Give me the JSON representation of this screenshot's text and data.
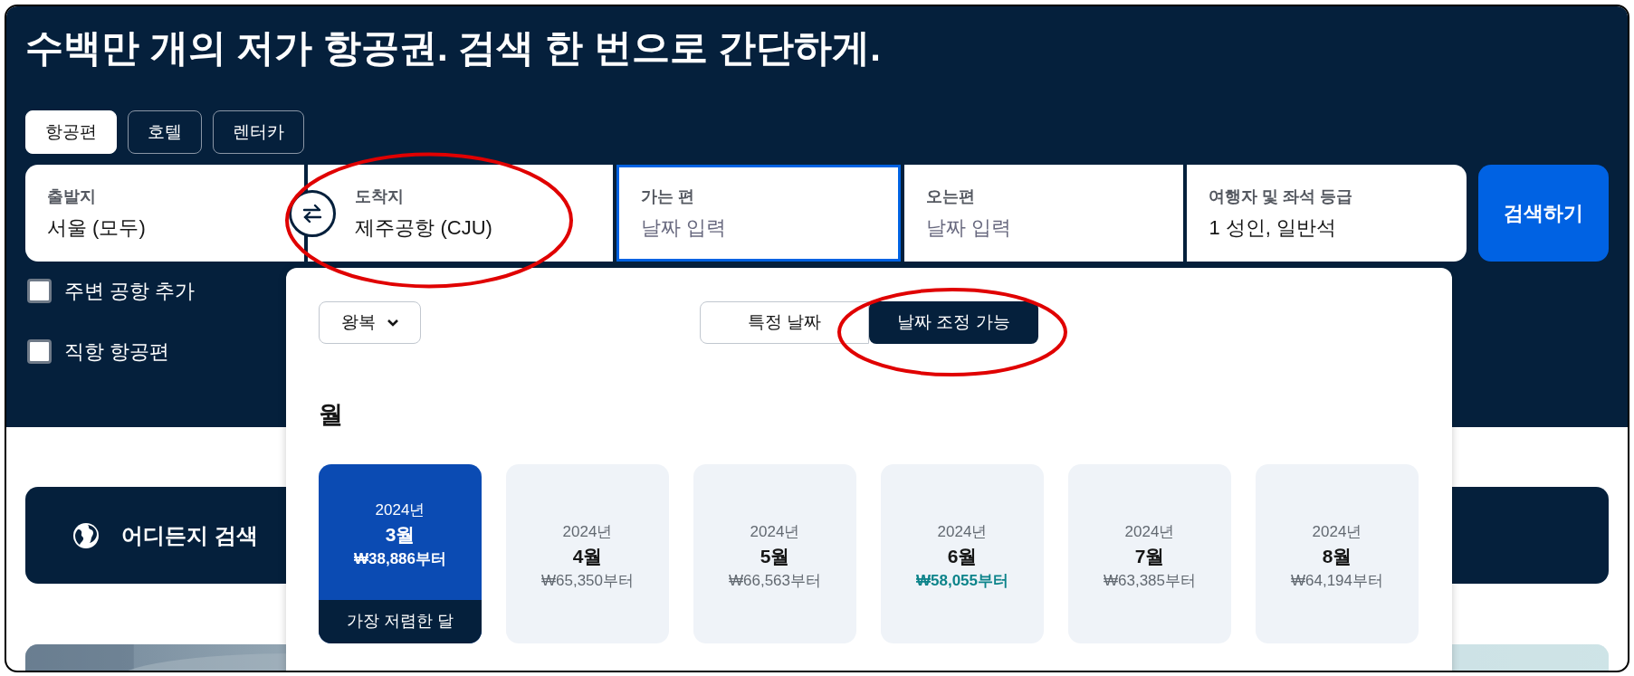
{
  "headline": "수백만 개의 저가 항공권. 검색 한 번으로 간단하게.",
  "tabs": [
    {
      "label": "항공편",
      "selected": true
    },
    {
      "label": "호텔",
      "selected": false
    },
    {
      "label": "렌터카",
      "selected": false
    }
  ],
  "search_fields": [
    {
      "label": "출발지",
      "value": "서울 (모두)",
      "focused": false
    },
    {
      "label": "도착지",
      "value": "제주공항 (CJU)",
      "focused": false
    },
    {
      "label": "가는 편",
      "placeholder": "날짜 입력",
      "focused": true
    },
    {
      "label": "오는편",
      "placeholder": "날짜 입력",
      "focused": false
    },
    {
      "label": "여행자 및 좌석 등급",
      "value": "1 성인, 일반석",
      "focused": false
    }
  ],
  "search_button": "검색하기",
  "options": [
    {
      "label": "주변 공항 추가",
      "checked": false
    },
    {
      "label": "직항 항공편",
      "checked": false
    }
  ],
  "search_anywhere": "어디든지 검색",
  "date_picker": {
    "trip_type": "왕복",
    "date_modes": [
      {
        "label": "특정 날짜",
        "selected": false
      },
      {
        "label": "날짜 조정 가능",
        "selected": true
      }
    ],
    "heading": "월",
    "months": [
      {
        "year": "2024년",
        "month": "3월",
        "price": "₩38,886부터",
        "selected": true,
        "highlight": false,
        "badge": "가장 저렴한 달"
      },
      {
        "year": "2024년",
        "month": "4월",
        "price": "₩65,350부터",
        "selected": false,
        "highlight": false
      },
      {
        "year": "2024년",
        "month": "5월",
        "price": "₩66,563부터",
        "selected": false,
        "highlight": false
      },
      {
        "year": "2024년",
        "month": "6월",
        "price": "₩58,055부터",
        "selected": false,
        "highlight": true
      },
      {
        "year": "2024년",
        "month": "7월",
        "price": "₩63,385부터",
        "selected": false,
        "highlight": false
      },
      {
        "year": "2024년",
        "month": "8월",
        "price": "₩64,194부터",
        "selected": false,
        "highlight": false
      }
    ]
  }
}
